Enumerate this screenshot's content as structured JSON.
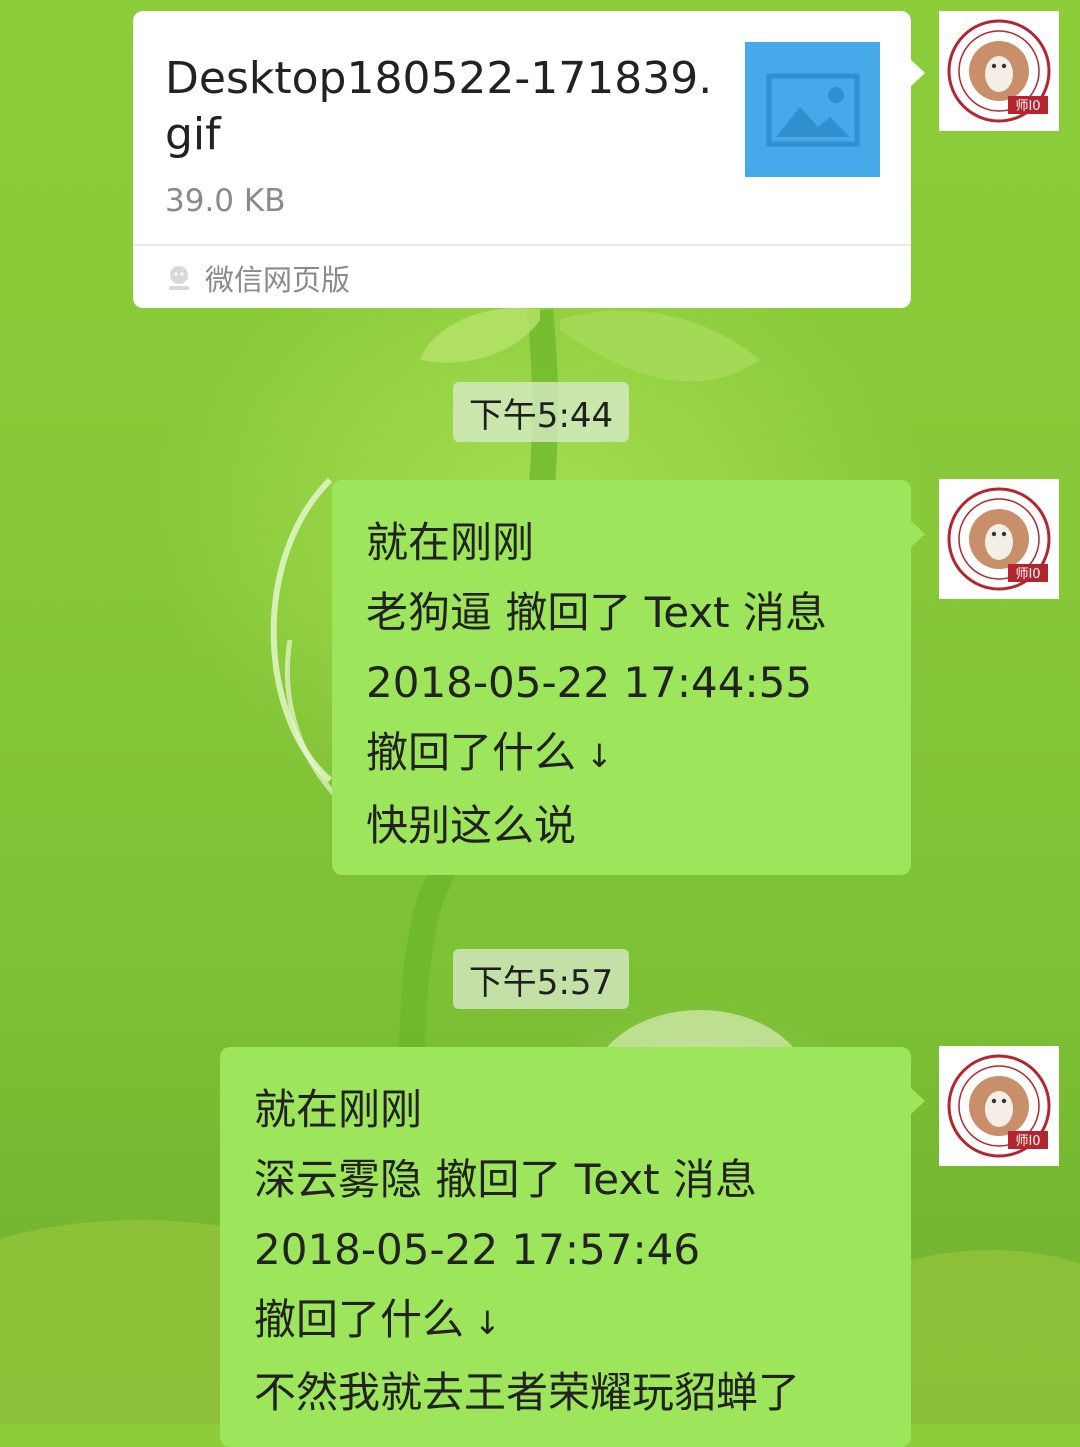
{
  "messages": {
    "file": {
      "filename_line1": "Desktop180522-171839.",
      "filename_line2": "gif",
      "size": "39.0 KB",
      "source": "微信网页版",
      "thumbnail_icon": "image-icon",
      "source_icon": "wechat-web-icon"
    },
    "time1": "下午5:44",
    "bubble1": {
      "line1": "就在刚刚",
      "line2": "老狗逼 撤回了 Text 消息",
      "line3": "2018-05-22 17:44:55",
      "line4": "撤回了什么",
      "line4_arrow": "↓",
      "line5": "快别这么说"
    },
    "time2": "下午5:57",
    "bubble2": {
      "line1": "就在刚刚",
      "line2": "深云雾隐 撤回了 Text 消息",
      "line3": "2018-05-22 17:57:46",
      "line4": "撤回了什么",
      "line4_arrow": "↓",
      "line5": "不然我就去王者荣耀玩貂蝉了"
    }
  },
  "avatar": {
    "icon": "university-seal-avatar",
    "label": "师I0"
  },
  "colors": {
    "bubble_green": "#9de65c",
    "file_card": "#ffffff",
    "thumbnail_blue": "#46a9ea",
    "background_green": "#86c838"
  }
}
